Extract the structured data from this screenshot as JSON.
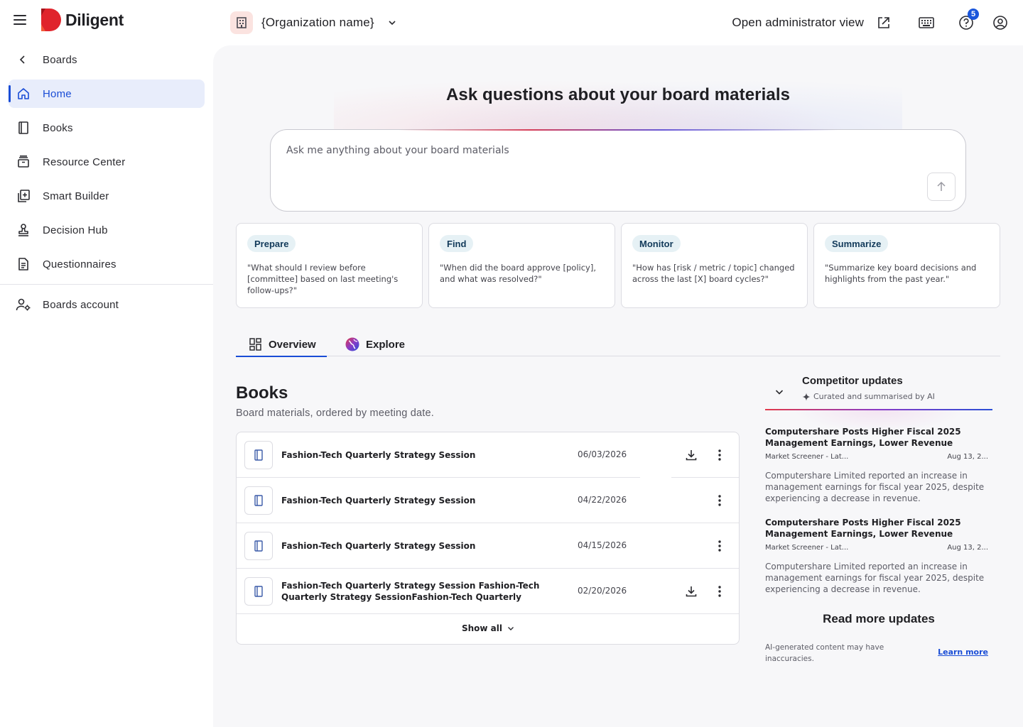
{
  "app": {
    "brand": "Diligent",
    "organization": "{Organization name}",
    "admin_link": "Open administrator view",
    "help_badge": "5"
  },
  "sidebar": {
    "back_label": "Boards",
    "items": [
      {
        "label": "Home",
        "icon": "home-icon",
        "active": true
      },
      {
        "label": "Books",
        "icon": "book-icon"
      },
      {
        "label": "Resource Center",
        "icon": "archive-icon"
      },
      {
        "label": "Smart Builder",
        "icon": "add-document-icon"
      },
      {
        "label": "Decision Hub",
        "icon": "stamp-icon"
      },
      {
        "label": "Questionnaires",
        "icon": "document-list-icon"
      }
    ],
    "account_label": "Boards account"
  },
  "hero": {
    "title": "Ask questions about your board materials",
    "placeholder": "Ask me anything about your board materials"
  },
  "prompts": [
    {
      "chip": "Prepare",
      "text": "\"What should I review before [committee] based on last meeting's follow-ups?\""
    },
    {
      "chip": "Find",
      "text": "\"When did the board approve [policy], and what was resolved?\""
    },
    {
      "chip": "Monitor",
      "text": "\"How has [risk / metric / topic] changed across the last [X] board cycles?\""
    },
    {
      "chip": "Summarize",
      "text": "\"Summarize key board decisions and highlights from the past year.\""
    }
  ],
  "tabs": [
    {
      "label": "Overview",
      "active": true
    },
    {
      "label": "Explore"
    }
  ],
  "books": {
    "title": "Books",
    "subtitle": "Board materials, ordered by meeting date.",
    "rows": [
      {
        "title": "Fashion-Tech Quarterly Strategy Session",
        "date": "06/03/2026",
        "download": true
      },
      {
        "title": "Fashion-Tech Quarterly Strategy Session",
        "date": "04/22/2026",
        "download": false
      },
      {
        "title": "Fashion-Tech Quarterly Strategy Session",
        "date": "04/15/2026",
        "download": false
      },
      {
        "title": "Fashion-Tech Quarterly Strategy Session  Fashion-Tech Quarterly Strategy SessionFashion-Tech Quarterly Strategy Se...",
        "date": "02/20/2026",
        "download": true
      }
    ],
    "show_all": "Show all"
  },
  "competitor": {
    "title": "Competitor updates",
    "subtitle": "Curated and summarised by AI",
    "news": [
      {
        "title": "Computershare Posts Higher Fiscal 2025 Management Earnings, Lower Revenue",
        "source": "Market Screener - Lat...",
        "date": "Aug 13, 2...",
        "body": "Computershare Limited reported an increase in management earnings for fiscal year 2025, despite experiencing a decrease in revenue."
      },
      {
        "title": "Computershare Posts Higher Fiscal 2025 Management Earnings, Lower Revenue",
        "source": "Market Screener - Lat...",
        "date": "Aug 13, 2...",
        "body": "Computershare Limited reported an increase in management earnings for fiscal year 2025, despite experiencing a decrease in revenue."
      }
    ],
    "read_more": "Read more updates",
    "disclaimer": "AI-generated content may have inaccuracies.",
    "learn_more": "Learn more"
  },
  "colors": {
    "accent": "#1a4dd6",
    "brand_red": "#e0242c",
    "chip_bg": "#e6f1f5"
  }
}
